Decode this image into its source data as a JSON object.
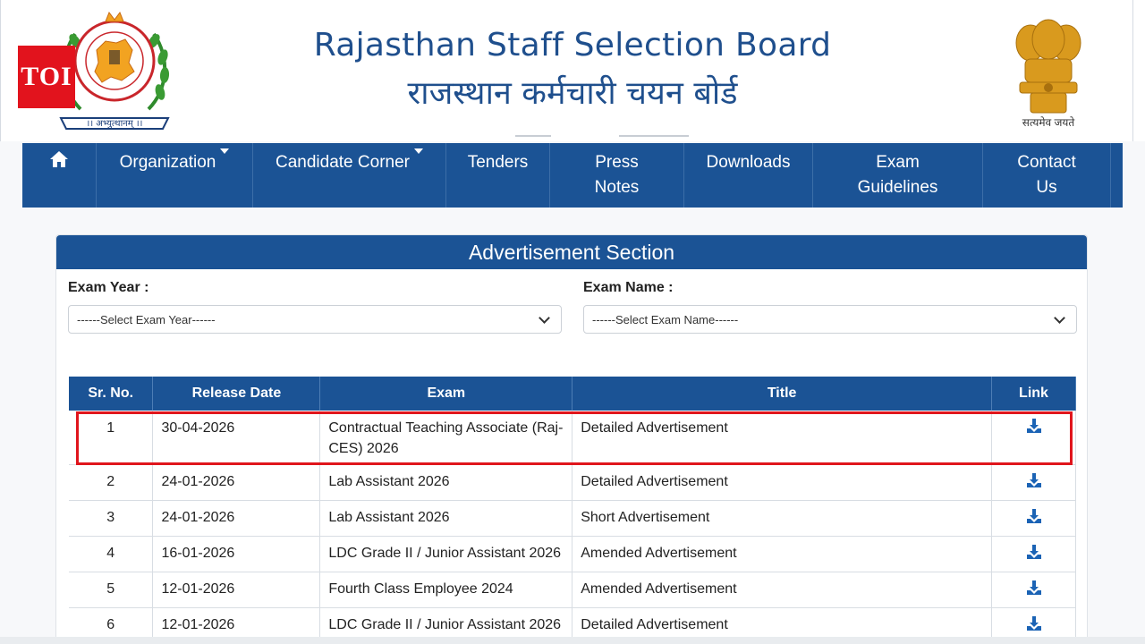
{
  "header": {
    "toi_badge": "TOI",
    "title_en": "Rajasthan Staff Selection Board",
    "title_hi": "राजस्थान कर्मचारी चयन बोर्ड",
    "logo_motto": "।। अभ्युत्थानम् ।।",
    "emblem_motto": "सत्यमेव जयते"
  },
  "nav": {
    "home_icon": "home-icon",
    "items": [
      {
        "label": "Organization",
        "dropdown": true
      },
      {
        "label": "Candidate Corner",
        "dropdown": true
      },
      {
        "label": "Tenders",
        "dropdown": false
      },
      {
        "label": "Press Notes",
        "dropdown": false
      },
      {
        "label": "Downloads",
        "dropdown": false
      },
      {
        "label": "Exam Guidelines",
        "dropdown": false
      },
      {
        "label": "Contact Us",
        "dropdown": false
      }
    ]
  },
  "advert": {
    "heading": "Advertisement Section",
    "year_label": "Exam Year :",
    "year_value": "------Select Exam Year------",
    "name_label": "Exam Name :",
    "name_value": "------Select Exam Name------"
  },
  "table": {
    "headers": [
      "Sr. No.",
      "Release Date",
      "Exam",
      "Title",
      "Link"
    ],
    "rows": [
      {
        "sr": "1",
        "date": "30-04-2026",
        "exam": "Contractual Teaching Associate (Raj-CES) 2026",
        "title": "Detailed Advertisement",
        "link": "download-icon"
      },
      {
        "sr": "2",
        "date": "24-01-2026",
        "exam": "Lab Assistant 2026",
        "title": "Detailed Advertisement",
        "link": "download-icon"
      },
      {
        "sr": "3",
        "date": "24-01-2026",
        "exam": "Lab Assistant 2026",
        "title": "Short Advertisement",
        "link": "download-icon"
      },
      {
        "sr": "4",
        "date": "16-01-2026",
        "exam": "LDC Grade II / Junior Assistant 2026",
        "title": "Amended Advertisement",
        "link": "download-icon"
      },
      {
        "sr": "5",
        "date": "12-01-2026",
        "exam": "Fourth Class Employee 2024",
        "title": "Amended Advertisement",
        "link": "download-icon"
      },
      {
        "sr": "6",
        "date": "12-01-2026",
        "exam": "LDC Grade II / Junior Assistant 2026",
        "title": "Detailed Advertisement",
        "link": "download-icon"
      }
    ]
  },
  "colors": {
    "brand_blue": "#1b5395",
    "title_blue": "#1f4f8d",
    "highlight_red": "#e0151c",
    "toi_red": "#e2131d"
  }
}
